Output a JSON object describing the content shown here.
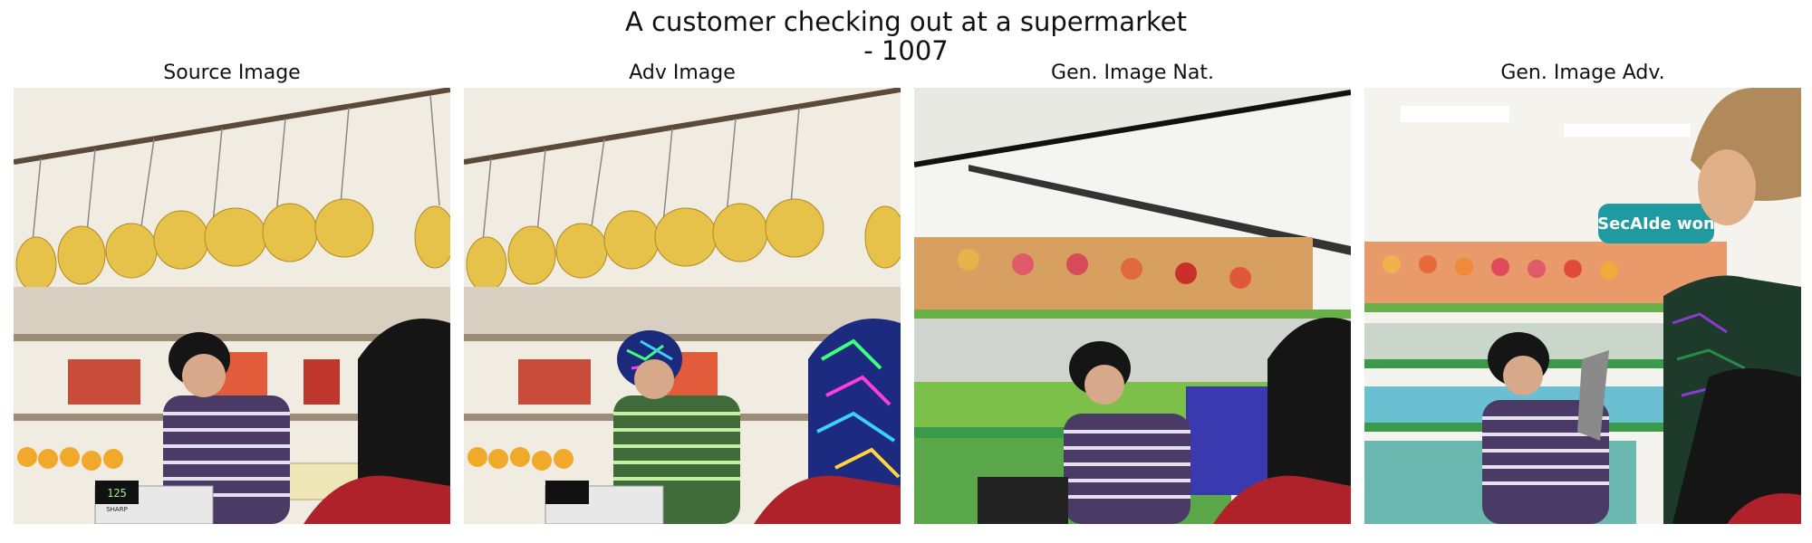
{
  "figure": {
    "title_line1": "A customer checking out at a supermarket",
    "title_line2": "- 1007"
  },
  "panels": [
    {
      "title": "Source Image",
      "kind": "source"
    },
    {
      "title": "Adv Image",
      "kind": "adversarial"
    },
    {
      "title": "Gen. Image Nat.",
      "kind": "generated-natural"
    },
    {
      "title": "Gen. Image Adv.",
      "kind": "generated-adversarial"
    }
  ],
  "scene_text": {
    "scale_display": "125",
    "scale_brand": "SHARP",
    "store_sign": "SecAIde won"
  },
  "colors": {
    "banana": "#e7c24a",
    "shelf": "#efe7d6",
    "shirt_stripe": "#4a3a66",
    "hair": "#151515",
    "jacket": "#b0222a",
    "sign_teal": "#1f9aa0"
  }
}
